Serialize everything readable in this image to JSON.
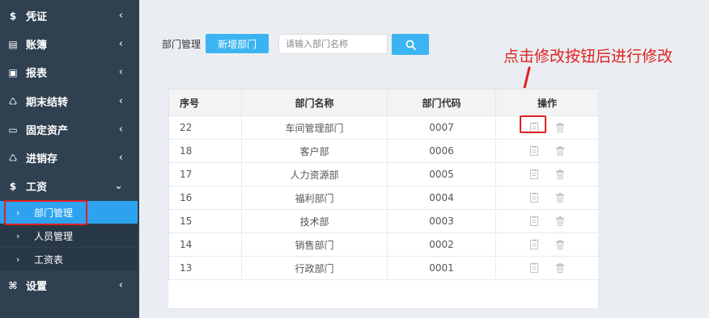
{
  "sidebar": {
    "items": [
      {
        "icon": "dollar-icon",
        "glyph": "$",
        "label": "凭证"
      },
      {
        "icon": "ledger-icon",
        "glyph": "▤",
        "label": "账簿"
      },
      {
        "icon": "report-icon",
        "glyph": "▣",
        "label": "报表"
      },
      {
        "icon": "period-close-icon",
        "glyph": "♺",
        "label": "期末结转"
      },
      {
        "icon": "monitor-icon",
        "glyph": "▭",
        "label": "固定资产"
      },
      {
        "icon": "inventory-icon",
        "glyph": "♺",
        "label": "进销存"
      },
      {
        "icon": "dollar-icon",
        "glyph": "$",
        "label": "工资"
      },
      {
        "icon": "settings-icon",
        "glyph": "⌘",
        "label": "设置"
      }
    ],
    "subitems": [
      {
        "label": "部门管理"
      },
      {
        "label": "人员管理"
      },
      {
        "label": "工资表"
      }
    ],
    "chevron_right": "‹",
    "chevron_down": "⌄",
    "sub_chevron": "›"
  },
  "toolbar": {
    "label": "部门管理",
    "add_button": "新增部门",
    "search_placeholder": "请输入部门名称"
  },
  "annotation": {
    "text": "点击修改按钮后进行修改"
  },
  "table": {
    "headers": [
      "序号",
      "部门名称",
      "部门代码",
      "操作"
    ],
    "rows": [
      {
        "id": "22",
        "name": "车间管理部门",
        "code": "0007"
      },
      {
        "id": "18",
        "name": "客户部",
        "code": "0006"
      },
      {
        "id": "17",
        "name": "人力资源部",
        "code": "0005"
      },
      {
        "id": "16",
        "name": "福利部门",
        "code": "0004"
      },
      {
        "id": "15",
        "name": "技术部",
        "code": "0003"
      },
      {
        "id": "14",
        "name": "销售部门",
        "code": "0002"
      },
      {
        "id": "13",
        "name": "行政部门",
        "code": "0001"
      }
    ]
  },
  "colors": {
    "sidebar_bg": "#2f4050",
    "submenu_bg": "#293846",
    "active": "#2da3f0",
    "button": "#3cb4f2",
    "highlight": "#e02020"
  }
}
